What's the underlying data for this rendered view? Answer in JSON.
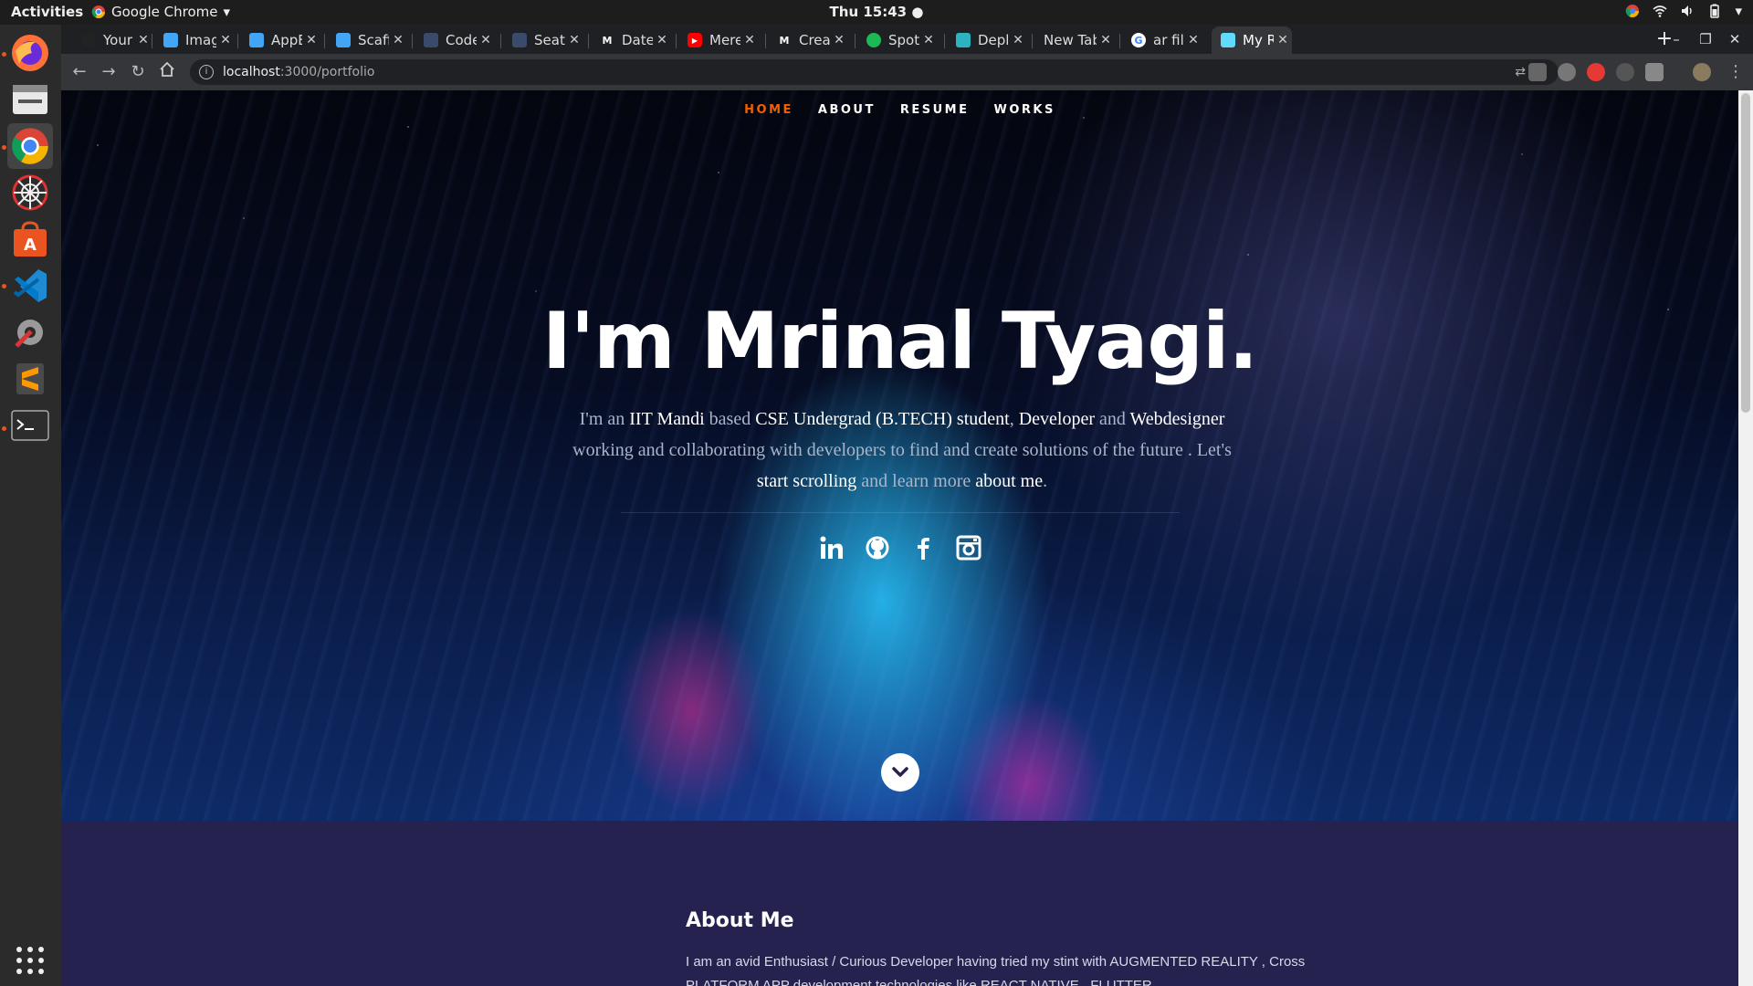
{
  "topbar": {
    "activities": "Activities",
    "app_name": "Google Chrome",
    "clock": "Thu 15:43"
  },
  "dock": {
    "items": [
      {
        "name": "firefox"
      },
      {
        "name": "files"
      },
      {
        "name": "chrome"
      },
      {
        "name": "spider-app"
      },
      {
        "name": "software-center"
      },
      {
        "name": "vscode"
      },
      {
        "name": "settings"
      },
      {
        "name": "sublime-text"
      },
      {
        "name": "terminal"
      },
      {
        "name": "show-applications"
      }
    ]
  },
  "tabs": [
    {
      "label": "Your Re",
      "icon": "github-icon",
      "color": "#222222"
    },
    {
      "label": "Image cl",
      "icon": "flutter-icon",
      "color": "#42a5f5"
    },
    {
      "label": "AppBar",
      "icon": "flutter-icon",
      "color": "#42a5f5"
    },
    {
      "label": "Scaffolc",
      "icon": "flutter-icon",
      "color": "#42a5f5"
    },
    {
      "label": "Code M",
      "icon": "doc-icon",
      "color": "#394a6b"
    },
    {
      "label": "Seating",
      "icon": "doc-icon",
      "color": "#394a6b"
    },
    {
      "label": "Date An",
      "icon": "medium-icon",
      "color": "#ffffff"
    },
    {
      "label": "Mere Ya",
      "icon": "youtube-icon",
      "color": "#ff0000"
    },
    {
      "label": "Create",
      "icon": "medium-icon",
      "color": "#ffffff"
    },
    {
      "label": "Spotify",
      "icon": "spotify-icon",
      "color": "#1db954"
    },
    {
      "label": "Deploy",
      "icon": "netlify-icon",
      "color": "#2bb3c0"
    },
    {
      "label": "New Tab",
      "icon": "",
      "color": ""
    },
    {
      "label": "ar filter",
      "icon": "google-icon",
      "color": "#4285f4"
    },
    {
      "label": "My Resu",
      "icon": "react-icon",
      "color": "#61dafb"
    }
  ],
  "active_tab_index": 13,
  "omnibox": {
    "host": "localhost",
    "path": ":3000/portfolio"
  },
  "site": {
    "nav": [
      {
        "label": "HOME",
        "current": true
      },
      {
        "label": "ABOUT",
        "current": false
      },
      {
        "label": "RESUME",
        "current": false
      },
      {
        "label": "WORKS",
        "current": false
      }
    ],
    "headline": "I'm Mrinal Tyagi.",
    "intro": {
      "p1": "I'm an ",
      "h1": "IIT Mandi",
      "p2": " based ",
      "h2": "CSE Undergrad (B.TECH) student",
      "p3": ", ",
      "h3": "Developer",
      "p4": " and ",
      "h4": "Webdesigner",
      "p5": " working and collaborating with developers to find and create solutions of the future . Let's ",
      "h5": "start scrolling",
      "p6": " and learn more ",
      "h6": "about me",
      "p7": "."
    },
    "social": [
      "linkedin-icon",
      "github-icon",
      "facebook-icon",
      "instagram-icon"
    ],
    "about_title": "About Me",
    "about_text": "I am an avid Enthusiast / Curious Developer having tried my stint with AUGMENTED REALITY , Cross PLATFORM APP development technologies like REACT NATIVE , FLUTTER"
  },
  "colors": {
    "accent": "#f06000",
    "about_bg": "#252250"
  }
}
